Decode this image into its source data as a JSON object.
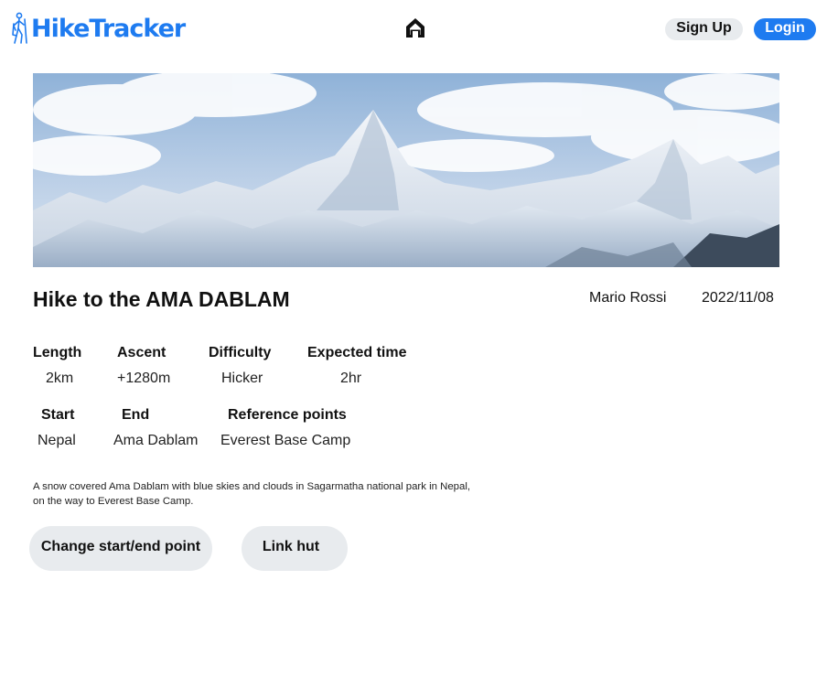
{
  "header": {
    "brand": "HikeTracker",
    "brand_color": "#1e7bf0",
    "logo_icon": "hiker-icon",
    "home_icon": "home-icon",
    "signup_label": "Sign Up",
    "login_label": "Login"
  },
  "hike": {
    "title": "Hike to the AMA DABLAM",
    "author": "Mario Rossi",
    "date": "2022/11/08",
    "details": {
      "length_label": "Length",
      "length_value": "2km",
      "ascent_label": "Ascent",
      "ascent_value": "+1280m",
      "difficulty_label": "Difficulty",
      "difficulty_value": "Hicker",
      "time_label": "Expected time",
      "time_value": "2hr",
      "start_label": "Start",
      "start_value": "Nepal",
      "end_label": "End",
      "end_value": "Ama Dablam",
      "refpoints_label": "Reference points",
      "refpoints_value": "Everest Base Camp"
    },
    "description": "A snow covered Ama Dablam with blue skies and clouds in Sagarmatha national park in Nepal, on the way to Everest Base Camp."
  },
  "actions": {
    "change_points_label": "Change start/end point",
    "link_hut_label": "Link hut"
  }
}
